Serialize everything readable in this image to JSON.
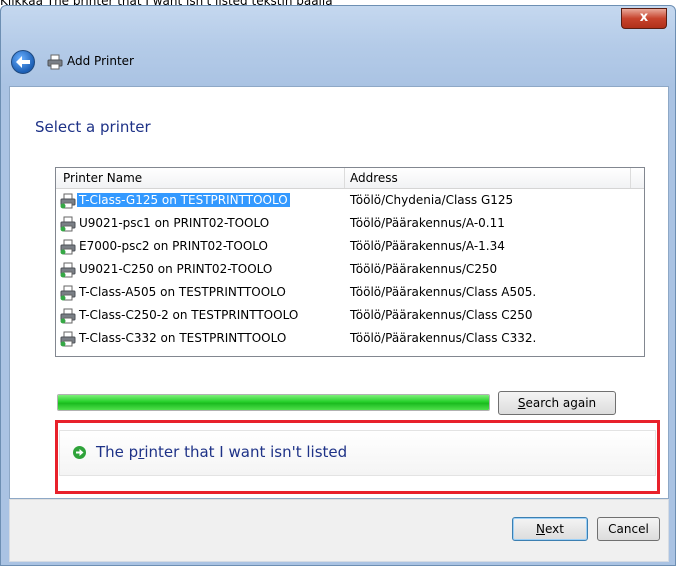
{
  "caption": "Klikkaa The printer that I want isn't listed tekstin päällä",
  "window": {
    "close_label": "x",
    "header_title": "Add Printer"
  },
  "section_title": "Select a printer",
  "list": {
    "columns": [
      "Printer Name",
      "Address"
    ],
    "rows": [
      {
        "name": "T-Class-G125 on TESTPRINTTOOLO",
        "address": "Töölö/Chydenia/Class G125",
        "selected": true
      },
      {
        "name": "U9021-psc1 on PRINT02-TOOLO",
        "address": "Töölö/Päärakennus/A-0.11"
      },
      {
        "name": "E7000-psc2 on PRINT02-TOOLO",
        "address": "Töölö/Päärakennus/A-1.34"
      },
      {
        "name": "U9021-C250 on PRINT02-TOOLO",
        "address": "Töölö/Päärakennus/C250"
      },
      {
        "name": "T-Class-A505 on TESTPRINTTOOLO",
        "address": "Töölö/Päärakennus/Class A505."
      },
      {
        "name": "T-Class-C250-2 on TESTPRINTTOOLO",
        "address": "Töölö/Päärakennus/Class C250"
      },
      {
        "name": "T-Class-C332 on TESTPRINTTOOLO",
        "address": "Töölö/Päärakennus/Class C332."
      }
    ]
  },
  "progress": {
    "value": 1.0
  },
  "search_again": {
    "mnemonic": "S",
    "rest": "earch again"
  },
  "not_listed_link": {
    "pre": "The p",
    "mnemonic": "r",
    "post": "inter that I want isn't listed"
  },
  "buttons": {
    "next": {
      "mnemonic": "N",
      "rest": "ext"
    },
    "cancel": "Cancel"
  },
  "colors": {
    "highlight": "#e8212b",
    "selection": "#3399ff",
    "link": "#1e3287",
    "progress": "#26d02a"
  }
}
